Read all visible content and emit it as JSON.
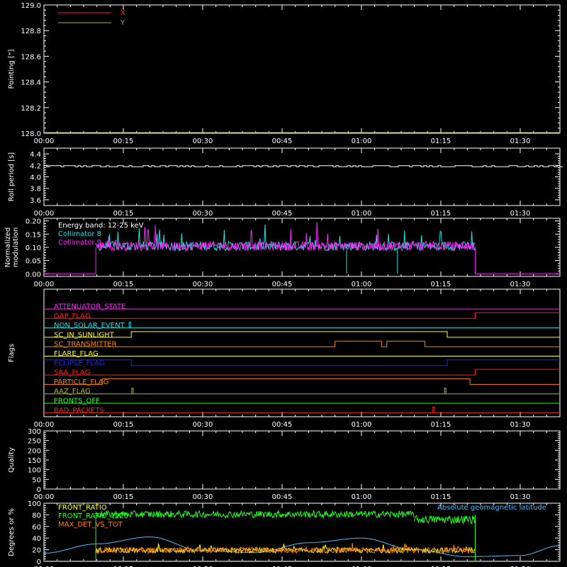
{
  "colors": {
    "background": "#000000",
    "axis": "#ffffff",
    "red": "#ff2020",
    "yellow_olive": "#b0b040",
    "cyan": "#20e0e0",
    "magenta": "#ff20ff",
    "green": "#20ff20",
    "orange": "#ff8000",
    "blue": "#2020ff",
    "yellow": "#ffff20",
    "sky": "#40c0ff"
  },
  "time_axis": {
    "ticks": [
      "00:00",
      "00:15",
      "00:30",
      "00:45",
      "01:00",
      "01:15",
      "01:30"
    ],
    "range_minutes": [
      0,
      97.5
    ]
  },
  "chart_data": [
    {
      "id": "pointing",
      "type": "line",
      "ylabel": "Pointing [\"]",
      "ylim": [
        128.0,
        129.0
      ],
      "yticks": [
        "128.0",
        "128.2",
        "128.4",
        "128.6",
        "128.8",
        "129.0"
      ],
      "legend": [
        {
          "name": "X",
          "color": "#ff2020"
        },
        {
          "name": "Y",
          "color": "#b0b040"
        }
      ],
      "series": [
        {
          "name": "Y",
          "x": [
            0,
            97.5
          ],
          "y": [
            128.0,
            128.0
          ]
        }
      ]
    },
    {
      "id": "roll",
      "type": "line",
      "ylabel": "Roll period [s]",
      "ylim": [
        3.5,
        4.5
      ],
      "yticks": [
        "3.6",
        "3.8",
        "4.0",
        "4.2",
        "4.4"
      ],
      "series": [
        {
          "name": "roll",
          "x": [
            0,
            97.5
          ],
          "y": [
            4.18,
            4.19
          ]
        }
      ]
    },
    {
      "id": "modulation",
      "type": "line",
      "ylabel": [
        "Normalized",
        "modulation"
      ],
      "ylim": [
        -0.01,
        0.21
      ],
      "yticks": [
        "0.00",
        "0.05",
        "0.10",
        "0.15",
        "0.20"
      ],
      "annotation": "Energy band: 12-25 keV",
      "legend": [
        {
          "name": "Collimator 8",
          "color": "#20e0e0"
        },
        {
          "name": "Collimator 9",
          "color": "#ff20ff"
        }
      ],
      "active_range": [
        9.8,
        81.5
      ],
      "cyan_dropouts": [
        57.2,
        66.8
      ]
    },
    {
      "id": "flags",
      "type": "line",
      "ylabel": "Flags",
      "flags": [
        {
          "name": "ATTENUATOR_STATE",
          "color": "#ff20ff",
          "segments": [
            [
              0,
              97.5,
              0
            ]
          ]
        },
        {
          "name": "GAP_FLAG",
          "color": "#ff2020",
          "segments": [
            [
              0,
              81.5,
              0
            ],
            [
              81.5,
              97.5,
              1
            ]
          ]
        },
        {
          "name": "NON_SOLAR_EVENT",
          "color": "#20e0e0",
          "segments": [
            [
              0,
              97.5,
              0
            ]
          ],
          "pulses": [
            16.1
          ]
        },
        {
          "name": "SC_IN_SUNLIGHT",
          "color": "#ffff20",
          "segments": [
            [
              0,
              16.5,
              0
            ],
            [
              16.5,
              76.2,
              1
            ],
            [
              76.2,
              97.5,
              0
            ]
          ]
        },
        {
          "name": "SC_TRANSMITTER",
          "color": "#ff8000",
          "segments": [
            [
              0,
              55.0,
              0
            ],
            [
              55.0,
              63.8,
              1
            ],
            [
              63.8,
              64.8,
              0
            ],
            [
              64.8,
              72.0,
              1
            ],
            [
              72.0,
              97.5,
              0
            ]
          ]
        },
        {
          "name": "FLARE_FLAG",
          "color": "#ffff20",
          "segments": [
            [
              0,
              97.5,
              0
            ]
          ]
        },
        {
          "name": "ECLIPSE_FLAG",
          "color": "#2020ff",
          "segments": [
            [
              0,
              16.5,
              1
            ],
            [
              16.5,
              76.2,
              0
            ],
            [
              76.2,
              97.5,
              1
            ]
          ]
        },
        {
          "name": "SAA_FLAG",
          "color": "#ff2020",
          "segments": [
            [
              0,
              81.5,
              0
            ],
            [
              81.5,
              97.5,
              1
            ]
          ]
        },
        {
          "name": "PARTICLE_FLAG",
          "color": "#ff8000",
          "segments": [
            [
              0,
              11.0,
              0
            ],
            [
              11.0,
              80.5,
              1
            ],
            [
              80.5,
              97.5,
              0
            ]
          ]
        },
        {
          "name": "AAZ_FLAG",
          "color": "#b0b040",
          "segments": [
            [
              0,
              97.5,
              0
            ]
          ],
          "pulses": [
            16.6,
            75.7
          ]
        },
        {
          "name": "FRONTS_OFF",
          "color": "#20ff20",
          "segments": [
            [
              0,
              97.5,
              0
            ]
          ]
        },
        {
          "name": "BAD_PACKETS",
          "color": "#ff2020",
          "segments": [
            [
              0,
              97.5,
              0
            ]
          ],
          "pulses": [
            73.5
          ]
        }
      ]
    },
    {
      "id": "quality",
      "type": "line",
      "ylabel": "Quality",
      "ylim": [
        0,
        300
      ],
      "yticks": [
        "0",
        "50",
        "100",
        "150",
        "200",
        "250",
        "300"
      ]
    },
    {
      "id": "ratios",
      "type": "line",
      "ylabel": "Degrees or %",
      "ylim": [
        0,
        100
      ],
      "yticks": [
        "0",
        "20",
        "40",
        "60",
        "80",
        "100"
      ],
      "legend": [
        {
          "name": "FRONT_RATIO",
          "color": "#ffff20"
        },
        {
          "name": "FRONT_RATIO_1225",
          "color": "#20ff20"
        },
        {
          "name": "MAX_DET_VS_TOT",
          "color": "#ff8000"
        }
      ],
      "annotation": "Absolute geomagnetic latitude",
      "annotation_color": "#40c0ff",
      "active_range": [
        9.8,
        81.5
      ],
      "latitude": {
        "x": [
          0,
          10,
          20,
          30,
          40,
          50,
          60,
          70,
          80,
          90,
          97.5
        ],
        "y": [
          14,
          30,
          42,
          18,
          15,
          32,
          40,
          20,
          8,
          10,
          27
        ]
      }
    }
  ]
}
